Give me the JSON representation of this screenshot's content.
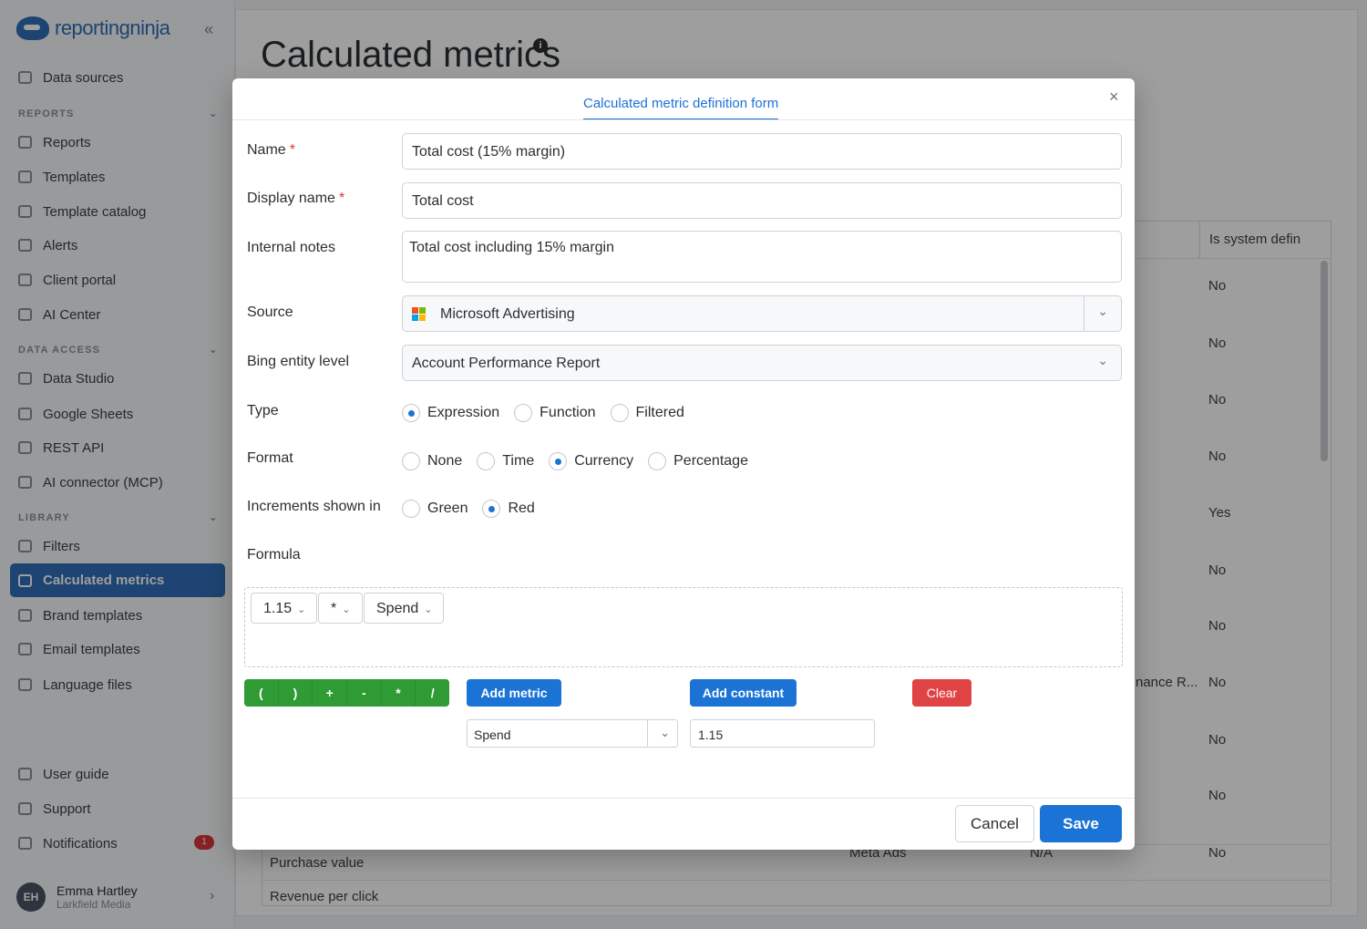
{
  "app": {
    "logo_text": "reportingninja",
    "collapse_icon": "«"
  },
  "sidebar": {
    "top_item": {
      "label": "Data sources",
      "icon": "database-icon"
    },
    "sections": [
      {
        "title": "REPORTS",
        "items": [
          {
            "label": "Reports",
            "icon": "report-icon"
          },
          {
            "label": "Templates",
            "icon": "template-icon"
          },
          {
            "label": "Template catalog",
            "icon": "catalog-icon"
          },
          {
            "label": "Alerts",
            "icon": "bell-icon"
          },
          {
            "label": "Client portal",
            "icon": "monitor-icon"
          },
          {
            "label": "AI Center",
            "icon": "sparkle-icon"
          }
        ]
      },
      {
        "title": "DATA ACCESS",
        "items": [
          {
            "label": "Data Studio",
            "icon": "nodes-icon"
          },
          {
            "label": "Google Sheets",
            "icon": "sheet-icon"
          },
          {
            "label": "REST API",
            "icon": "code-icon"
          },
          {
            "label": "AI connector (MCP)",
            "icon": "connector-icon"
          }
        ]
      },
      {
        "title": "LIBRARY",
        "items": [
          {
            "label": "Filters",
            "icon": "filter-icon"
          },
          {
            "label": "Calculated metrics",
            "icon": "calculator-icon",
            "active": true
          },
          {
            "label": "Brand templates",
            "icon": "brush-icon"
          },
          {
            "label": "Email templates",
            "icon": "mail-icon"
          },
          {
            "label": "Language files",
            "icon": "language-icon"
          }
        ]
      }
    ],
    "bottom_items": [
      {
        "label": "User guide",
        "icon": "book-icon"
      },
      {
        "label": "Support",
        "icon": "support-icon"
      },
      {
        "label": "Notifications",
        "icon": "bell-icon",
        "badge": "1"
      }
    ],
    "user": {
      "initials": "EH",
      "name": "Emma Hartley",
      "org": "Larkfield Media"
    }
  },
  "page": {
    "title": "Calculated metrics",
    "info_icon": "i",
    "table_header_right": "Is system defin",
    "right_column": [
      "No",
      "No",
      "No",
      "No",
      "Yes",
      "No",
      "No",
      "No",
      "No",
      "No",
      "No"
    ],
    "row_fragment": "nance R...",
    "bottom_rows": [
      {
        "name": "Purchase value",
        "source": "Meta Ads",
        "level": "N/A"
      },
      {
        "name": "Revenue per click"
      }
    ]
  },
  "modal": {
    "tab_label": "Calculated metric definition form",
    "close_icon": "×",
    "name": {
      "label": "Name",
      "required_mark": "*",
      "value": "Total cost (15% margin)"
    },
    "display_name": {
      "label": "Display name",
      "required_mark": "*",
      "value": "Total cost"
    },
    "internal_notes": {
      "label": "Internal notes",
      "value": "Total cost including 15% margin"
    },
    "source": {
      "label": "Source",
      "value": "Microsoft Advertising",
      "logo_colors": [
        "#f25022",
        "#7fba00",
        "#00a4ef",
        "#ffb900"
      ]
    },
    "entity_level": {
      "label": "Bing entity level",
      "value": "Account Performance Report"
    },
    "type": {
      "label": "Type",
      "options": [
        "Expression",
        "Function",
        "Filtered"
      ],
      "selected": "Expression"
    },
    "format": {
      "label": "Format",
      "options": [
        "None",
        "Time",
        "Currency",
        "Percentage"
      ],
      "selected": "Currency"
    },
    "increments": {
      "label": "Increments shown in",
      "options": [
        "Green",
        "Red"
      ],
      "selected": "Red"
    },
    "formula": {
      "label": "Formula",
      "tokens": [
        "1.15",
        "*",
        "Spend"
      ],
      "operators": [
        "(",
        ")",
        "+",
        "-",
        "*",
        "/"
      ],
      "add_metric_label": "Add metric",
      "add_constant_label": "Add constant",
      "clear_label": "Clear",
      "metric_select_value": "Spend",
      "constant_value": "1.15"
    },
    "cancel_label": "Cancel",
    "save_label": "Save"
  },
  "colors": {
    "accent": "#1b73d6",
    "operators": "#2e9b35",
    "danger": "#e04343",
    "required": "#d9363e",
    "sidebar_active": "#2f6fb8"
  }
}
